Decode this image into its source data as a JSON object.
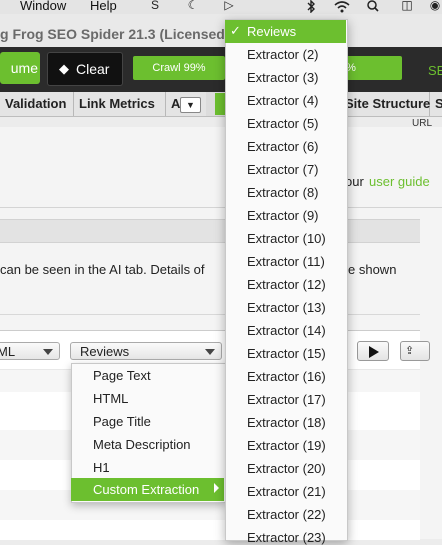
{
  "menubar": {
    "window": "Window",
    "help": "Help"
  },
  "app": {
    "title": "g Frog SEO Spider 21.3 (Licensed)"
  },
  "toolbar": {
    "resume_label": "ume",
    "clear_label": "Clear",
    "crawl_progress": "Crawl 99%",
    "analysis_progress": "%",
    "se_label": "SE"
  },
  "tabs": {
    "validation": "Validation",
    "link_metrics": "Link Metrics",
    "a": "A",
    "site_structure": "Site Structure",
    "s": "S"
  },
  "url_fragment": "URL",
  "content": {
    "guide_prefix": "our",
    "guide_link": "user guide",
    "description": "can be seen in the AI tab. Details of",
    "description_end": "e shown"
  },
  "panel": {
    "html_select": "ML",
    "reviews_select": "Reviews"
  },
  "field_menu": {
    "items": [
      "Page Text",
      "HTML",
      "Page Title",
      "Meta Description",
      "H1"
    ],
    "custom_extraction": "Custom Extraction"
  },
  "extractor_menu": {
    "selected": "Reviews",
    "items": [
      "Extractor (2)",
      "Extractor (3)",
      "Extractor (4)",
      "Extractor (5)",
      "Extractor (6)",
      "Extractor (7)",
      "Extractor (8)",
      "Extractor (9)",
      "Extractor (10)",
      "Extractor (11)",
      "Extractor (12)",
      "Extractor (13)",
      "Extractor (14)",
      "Extractor (15)",
      "Extractor (16)",
      "Extractor (17)",
      "Extractor (18)",
      "Extractor (19)",
      "Extractor (20)",
      "Extractor (21)",
      "Extractor (22)",
      "Extractor (23)"
    ]
  },
  "colors": {
    "accent": "#6cbf2f",
    "toolbar_bg": "#2b2b2b"
  }
}
